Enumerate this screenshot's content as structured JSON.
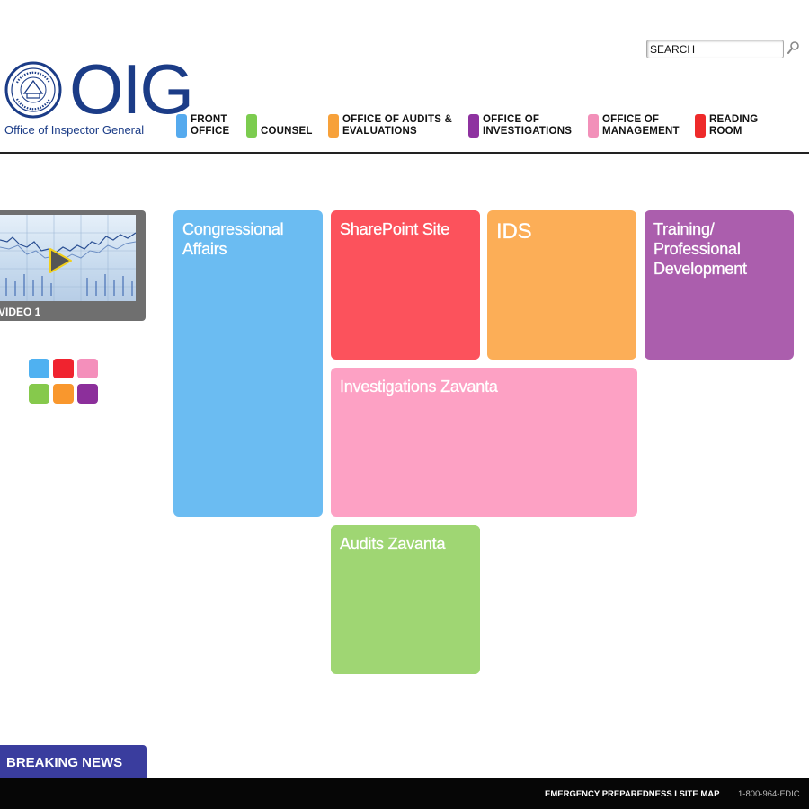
{
  "logo": {
    "letters": "OIG",
    "subtitle": "Office of Inspector General",
    "seal_text": "FEDERAL DEPOSIT INSURANCE CORPORATION",
    "seal_year": "1933"
  },
  "search": {
    "placeholder": "SEARCH",
    "icon": "magnifier-icon"
  },
  "nav": {
    "items": [
      {
        "line1": "FRONT",
        "line2": "OFFICE",
        "color": "#55aaee"
      },
      {
        "line1": "",
        "line2": "COUNSEL",
        "color": "#7ccc4f"
      },
      {
        "line1": "OFFICE OF AUDITS &",
        "line2": "EVALUATIONS",
        "color": "#f7a13a"
      },
      {
        "line1": "OFFICE OF",
        "line2": "INVESTIGATIONS",
        "color": "#8e32a0"
      },
      {
        "line1": "OFFICE OF",
        "line2": "MANAGEMENT",
        "color": "#f290b9"
      },
      {
        "line1": "READING",
        "line2": "ROOM",
        "color": "#ee2a2a"
      }
    ]
  },
  "video": {
    "label": "VIDEO 1",
    "icon": "play-icon"
  },
  "swatches": [
    "#4fb1f1",
    "#f0232f",
    "#f48fbb",
    "#86c94c",
    "#f9972d",
    "#8c2f9b"
  ],
  "tiles": {
    "congressional": {
      "title": "Congressional Affairs",
      "color": "#6bbcf2"
    },
    "sharepoint": {
      "title": "SharePoint Site",
      "color": "#fc525c"
    },
    "ids": {
      "title": "IDS",
      "color": "#fcae57"
    },
    "training": {
      "title": "Training/ Professional Development",
      "color": "#ab5ead"
    },
    "investigations": {
      "title": "Investigations Zavanta",
      "color": "#fda1c4"
    },
    "audits": {
      "title": "Audits Zavanta",
      "color": "#9fd673"
    }
  },
  "breaking_news": {
    "label": "BREAKING NEWS",
    "color": "#3a3d9e"
  },
  "footer": {
    "links": "EMERGENCY PREPAREDNESS I SITE MAP",
    "phone": "1-800-964-FDIC"
  }
}
